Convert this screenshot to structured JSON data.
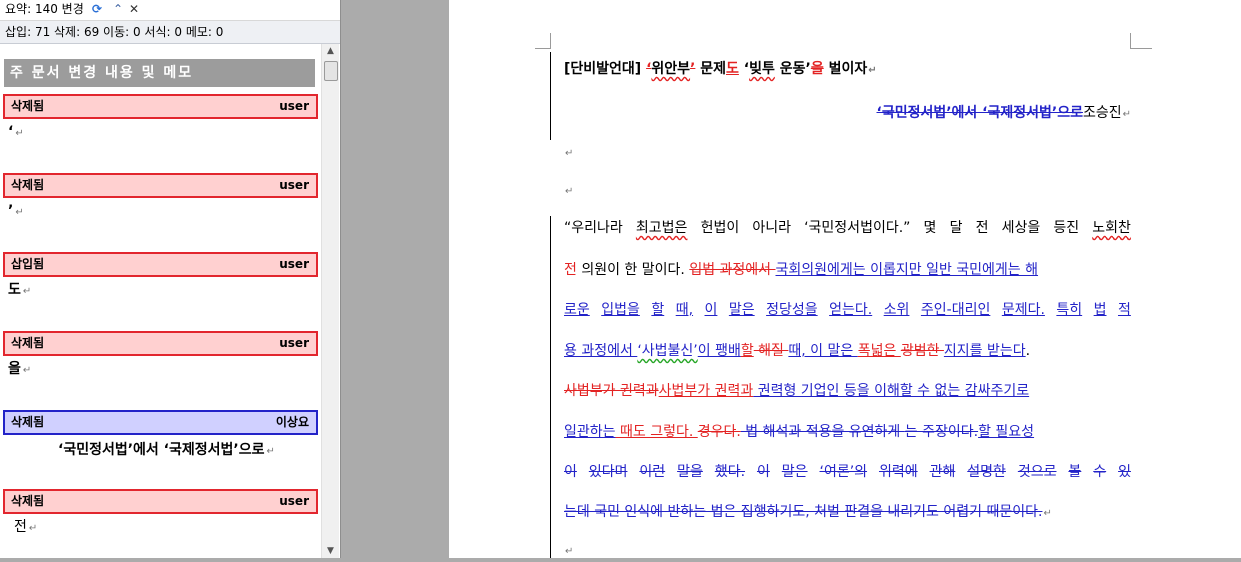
{
  "pane": {
    "summary": "요약: 140 변경",
    "counts": "삽입: 71 삭제: 69 이동: 0 서식: 0 메모: 0",
    "section_title": "주 문서 변경 내용 및 메모",
    "revisions": [
      {
        "type": "삭제됨",
        "author": "user",
        "text": "‘"
      },
      {
        "type": "삭제됨",
        "author": "user",
        "text": "’"
      },
      {
        "type": "삽입됨",
        "author": "user",
        "text": "도"
      },
      {
        "type": "삭제됨",
        "author": "user",
        "text": "을"
      },
      {
        "type": "삭제됨",
        "author": "이상요",
        "text": "‘국민정서법’에서 ‘국제정서법’으로"
      },
      {
        "type": "삭제됨",
        "author": "user",
        "text": "전"
      }
    ]
  },
  "doc": {
    "title": {
      "t1": "[단비발언대] ",
      "t2": "‘",
      "t3": "위안부",
      "t4": "’",
      "t5": " 문제",
      "t6": "도",
      "t7": " ‘",
      "t8": "빚투",
      "t9": " 운동’",
      "t10": "을",
      "t11": " 벌이자"
    },
    "subtitle": {
      "s1": "‘국민정서법’에서 ‘국제정서법’으로",
      "s2": "조승진"
    },
    "para": {
      "l1": [
        "“우리나라",
        "최고법은",
        "헌법이",
        "아니라",
        "‘국민정서법이다.”",
        "몇",
        "달",
        "전",
        "세상을",
        "등진",
        "노회찬"
      ],
      "l2": {
        "a": "전",
        "b": " 의원이 한 말이다. ",
        "c": "입법 과정에서 ",
        "d": "국회의원에게는 이롭지만 일반 국민에게는 해"
      },
      "l3": [
        "로운",
        "입법을",
        "할",
        "때,",
        "이",
        "말은",
        "정당성을",
        "얻는다.",
        "소위",
        "주인-대리인",
        "문제다.",
        "특히",
        "법",
        "적"
      ],
      "l4": {
        "a": "용 과정에서 ",
        "b": "‘사법불신’",
        "c": "이 팽배",
        "d": "할",
        "e": " 해질 ",
        "f": "때, 이 말은 ",
        "g": "폭넓은 ",
        "h": "광범한 ",
        "i": "지지를 받는다",
        "j": "."
      },
      "l5": {
        "a": "사법부가 권력과",
        "b": "사법부가 권력과",
        "c": " 권력형 기업인 등을 이해할 수 없는 감싸주기로"
      },
      "l6": {
        "a": "일관하는",
        "b": " 때도 그렇다. ",
        "c": "경우다.",
        "d": " 법 해석과 적용을 유연하게 ",
        "e": "는 주장이다.",
        "f": "할 필요성"
      },
      "l7": [
        "이",
        "있다며",
        "이런",
        "말을",
        "했다.",
        "이",
        "말은",
        "‘여론’의",
        "위력에",
        "관해",
        "설명한",
        "것으로",
        "볼",
        "수",
        "있"
      ],
      "l8": "는데 국민 인식에 반하는 법은 집행하기도, 처벌 판결을 내리기도 어렵기 때문이다."
    }
  },
  "colors": {
    "deletion": "#e32323",
    "moved": "#2323c8",
    "accent_gray": "#9c9c9c"
  }
}
